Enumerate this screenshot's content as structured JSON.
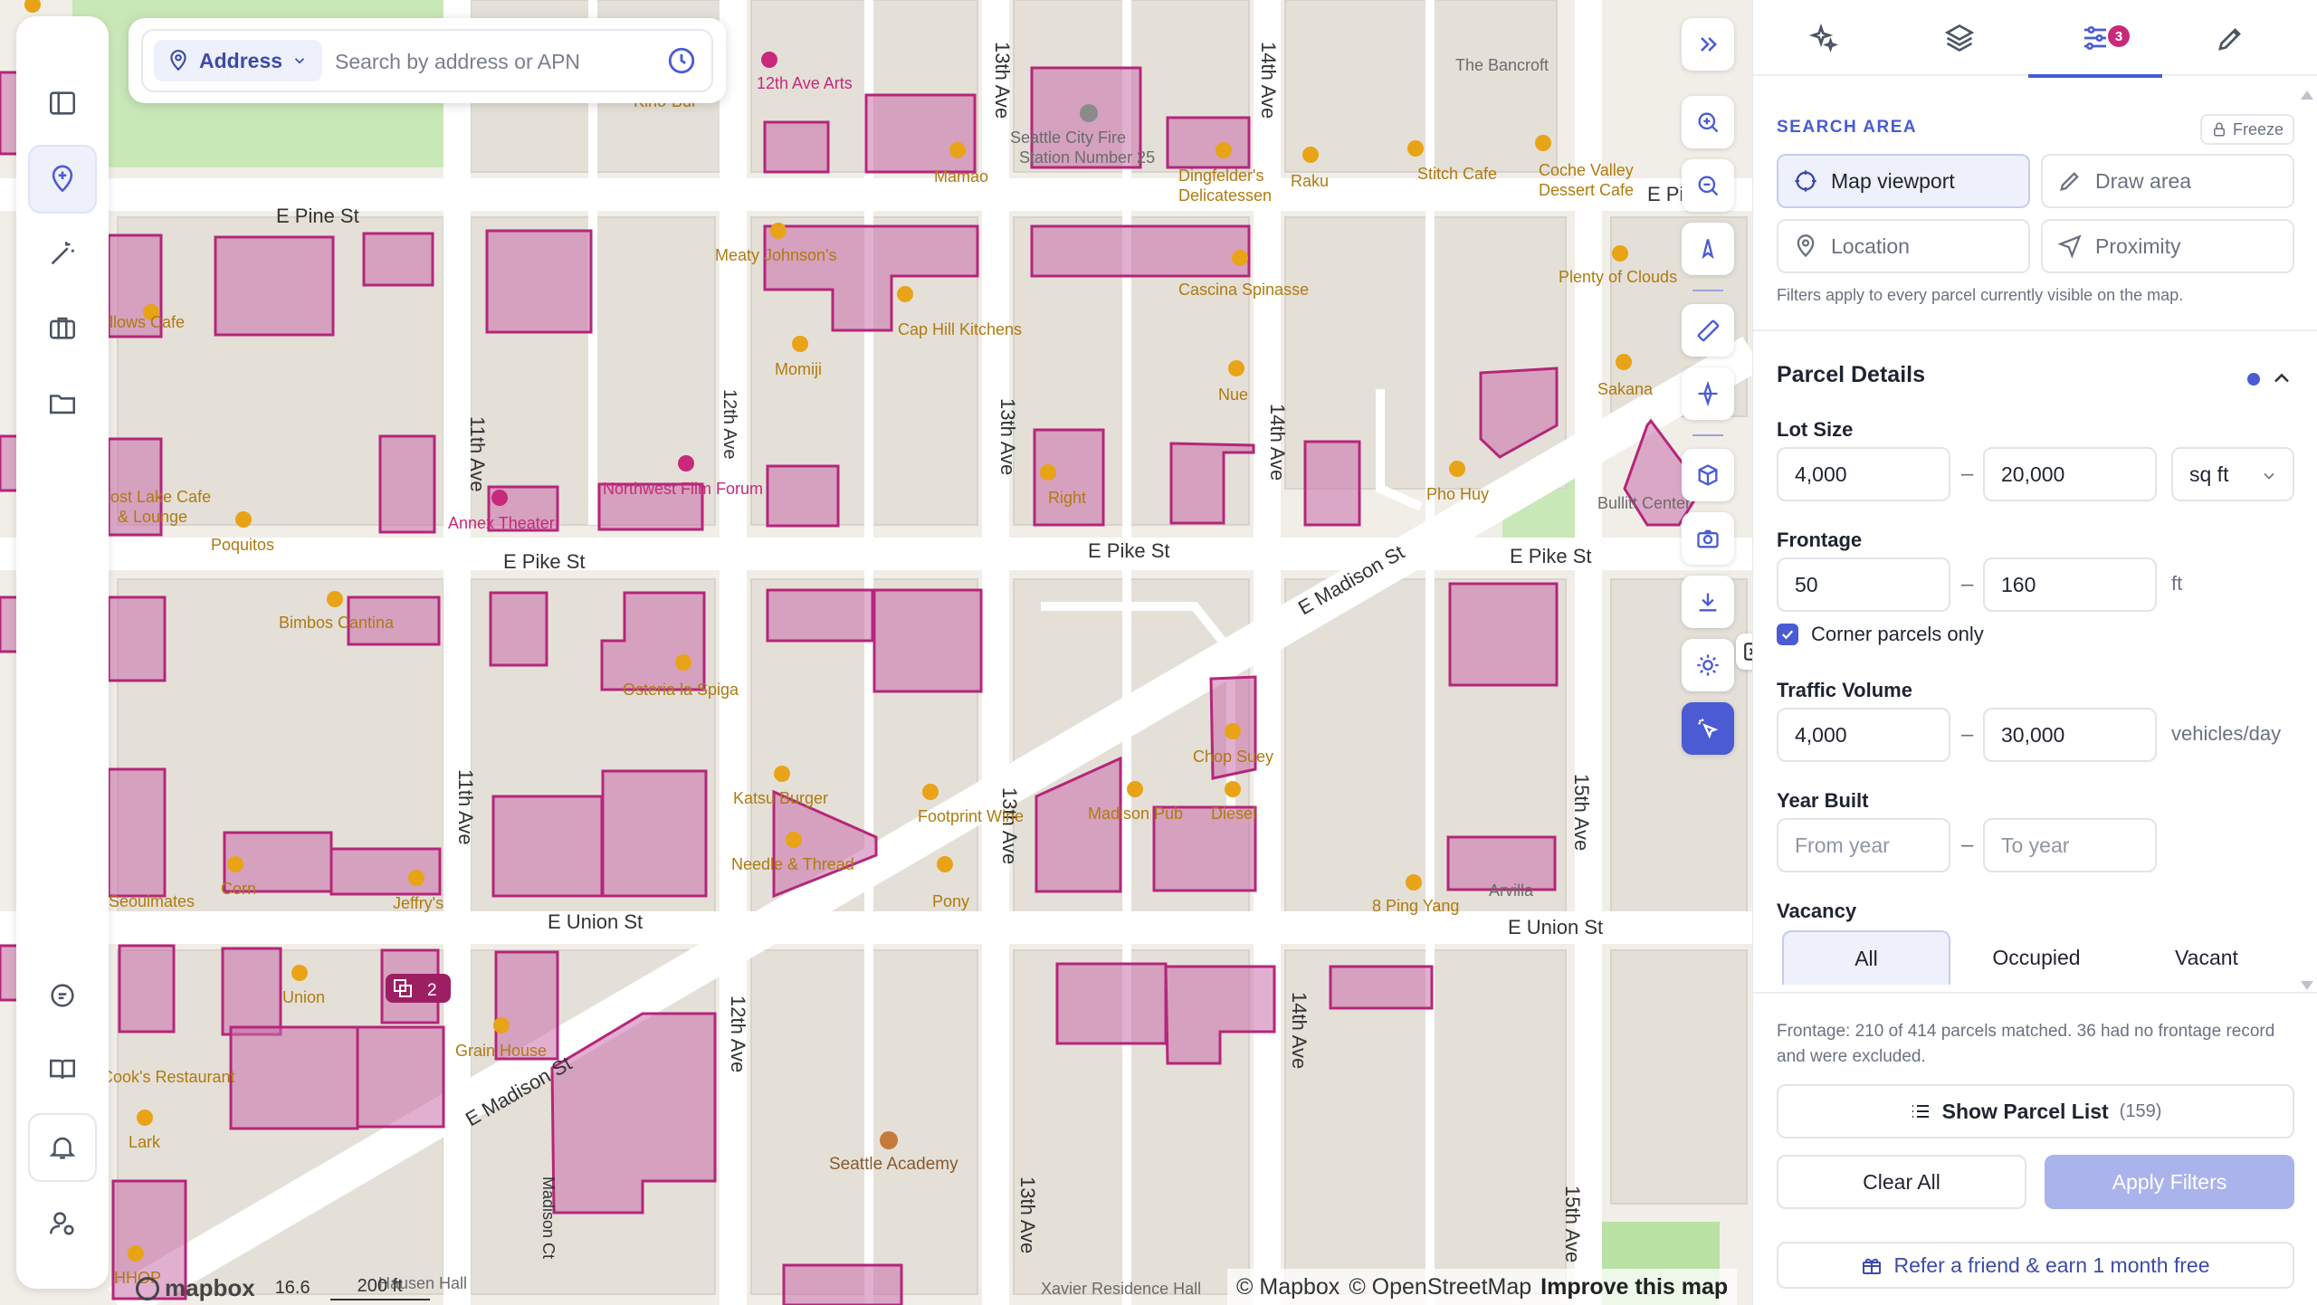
{
  "search": {
    "mode_label": "Address",
    "placeholder": "Search by address or APN"
  },
  "map": {
    "streets": [
      "E Pine St",
      "E Pine St",
      "E Pike St",
      "E Pike St",
      "E Pike St",
      "E Union St",
      "E Union St",
      "E Madison St",
      "E Madison St",
      "11th Ave",
      "11th Ave",
      "12th Ave",
      "12th Ave",
      "13th Ave",
      "13th Ave",
      "13th Ave",
      "13th Ave",
      "14th Ave",
      "14th Ave",
      "14th Ave",
      "15th Ave",
      "15th Ave",
      "Madison Ct"
    ],
    "pois": [
      {
        "name": "Seattle City Fire Station Number 25",
        "color": "#6f6f6f"
      },
      {
        "name": "Mamao",
        "color": "#c8860d"
      },
      {
        "name": "Dingfelder's Delicatessen",
        "color": "#c8860d"
      },
      {
        "name": "Raku",
        "color": "#c8860d"
      },
      {
        "name": "Stitch Cafe",
        "color": "#c8860d"
      },
      {
        "name": "Coche Valley Dessert Cafe",
        "color": "#c8860d"
      },
      {
        "name": "The Bancroft",
        "color": "#555"
      },
      {
        "name": "Meaty Johnson's",
        "color": "#c8860d"
      },
      {
        "name": "Cap Hill Kitchens",
        "color": "#c8860d"
      },
      {
        "name": "Momiji",
        "color": "#c8860d"
      },
      {
        "name": "Cascina Spinasse",
        "color": "#c8860d"
      },
      {
        "name": "Nue",
        "color": "#c8860d"
      },
      {
        "name": "Plenty of Clouds",
        "color": "#c8860d"
      },
      {
        "name": "Sakana",
        "color": "#c8860d"
      },
      {
        "name": "Pho Huy",
        "color": "#c8860d"
      },
      {
        "name": "Bullitt Center",
        "color": "#555"
      },
      {
        "name": "Poquitos",
        "color": "#c8860d"
      },
      {
        "name": "Lost Lake Cafe & Lounge",
        "color": "#c8860d"
      },
      {
        "name": "Oddfellows Cafe",
        "color": "#c8860d"
      },
      {
        "name": "Annex Theater",
        "color": "#c8297a"
      },
      {
        "name": "Northwest Film Forum",
        "color": "#c8297a"
      },
      {
        "name": "Right",
        "color": "#c8860d"
      },
      {
        "name": "Bimbos Cantina",
        "color": "#c8860d"
      },
      {
        "name": "Osteria la Spiga",
        "color": "#c8860d"
      },
      {
        "name": "Chop Suey",
        "color": "#c8860d"
      },
      {
        "name": "Madison Pub",
        "color": "#c8860d"
      },
      {
        "name": "Diesel",
        "color": "#c8860d"
      },
      {
        "name": "Katsu Burger",
        "color": "#c8860d"
      },
      {
        "name": "Footprint Wine",
        "color": "#c8860d"
      },
      {
        "name": "Needle & Thread",
        "color": "#c8860d"
      },
      {
        "name": "Pony",
        "color": "#c8860d"
      },
      {
        "name": "8 Ping Yang",
        "color": "#c8860d"
      },
      {
        "name": "Arvilla",
        "color": "#555"
      },
      {
        "name": "Seoulmates",
        "color": "#c8860d"
      },
      {
        "name": "Jeffry's",
        "color": "#c8860d"
      },
      {
        "name": "Corn",
        "color": "#c8860d"
      },
      {
        "name": "Union",
        "color": "#c8860d"
      },
      {
        "name": "Grain House",
        "color": "#c8860d"
      },
      {
        "name": "Lark",
        "color": "#c8860d"
      },
      {
        "name": "Cook's Restaurant",
        "color": "#c8860d"
      },
      {
        "name": "Seattle Academy",
        "color": "#8a5a2b"
      },
      {
        "name": "Xavier Residence Hall",
        "color": "#555"
      },
      {
        "name": "Hausen Hall",
        "color": "#555"
      },
      {
        "name": "12th Ave Arts",
        "color": "#c8297a"
      },
      {
        "name": "HHOP",
        "color": "#c8860d"
      },
      {
        "name": "Kino-Bui",
        "color": "#c8860d"
      }
    ],
    "cluster_count": "2",
    "zoom_readout": "16.6",
    "scale_label": "200 ft",
    "parcel_color": "#b5267a",
    "parcel_fill": "rgba(200,110,170,0.55)",
    "attribution": {
      "mapbox": "© Mapbox",
      "osm": "© OpenStreetMap",
      "improve": "Improve this map"
    },
    "logo": "mapbox"
  },
  "rail": {
    "icons": [
      "sidebar-toggle-icon",
      "add-location-icon",
      "magic-wand-icon",
      "briefcase-icon",
      "folder-icon",
      "chat-icon",
      "book-icon",
      "bell-icon",
      "user-settings-icon"
    ]
  },
  "panel": {
    "tab_badge": "3",
    "search_area": {
      "title": "SEARCH AREA",
      "freeze": "Freeze",
      "options": [
        "Map viewport",
        "Draw area",
        "Location",
        "Proximity"
      ],
      "selected": "Map viewport",
      "help": "Filters apply to every parcel currently visible on the map."
    },
    "parcel_details": {
      "title": "Parcel Details",
      "lot_size": {
        "label": "Lot Size",
        "min": "4,000",
        "max": "20,000",
        "unit": "sq ft"
      },
      "frontage": {
        "label": "Frontage",
        "min": "50",
        "max": "160",
        "unit": "ft"
      },
      "corner_only": {
        "label": "Corner parcels only",
        "checked": true
      },
      "traffic": {
        "label": "Traffic Volume",
        "min": "4,000",
        "max": "30,000",
        "unit": "vehicles/day"
      },
      "year_built": {
        "label": "Year Built",
        "min_placeholder": "From year",
        "max_placeholder": "To year"
      },
      "vacancy": {
        "label": "Vacancy",
        "options": [
          "All",
          "Occupied",
          "Vacant"
        ],
        "selected": "All"
      }
    },
    "footer": {
      "match_note": "Frontage: 210 of 414 parcels matched. 36 had no frontage record and were excluded.",
      "show_list": "Show Parcel List",
      "show_list_count": "(159)",
      "clear": "Clear All",
      "apply": "Apply Filters",
      "refer": "Refer a friend & earn 1 month free"
    }
  },
  "colors": {
    "accent": "#4a5bd4",
    "badge": "#c8297a",
    "poi_food": "#e8a317"
  }
}
